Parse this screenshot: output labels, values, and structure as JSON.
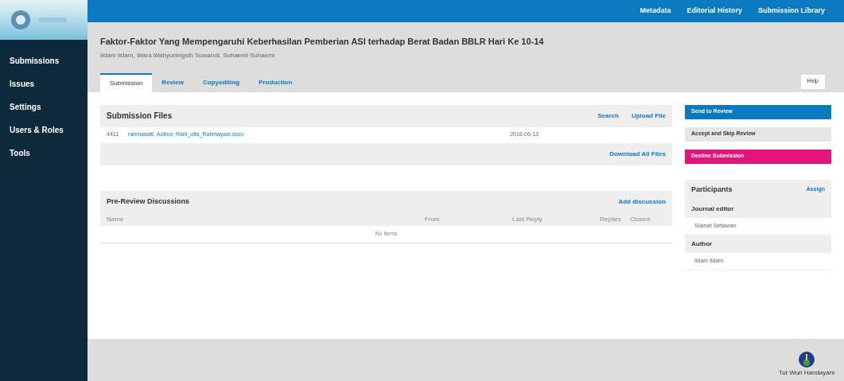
{
  "sidebar": {
    "items": [
      {
        "label": "Submissions",
        "selected": false
      },
      {
        "label": "Issues",
        "selected": false
      },
      {
        "label": "Settings",
        "selected": false
      },
      {
        "label": "Users & Roles",
        "selected": false
      },
      {
        "label": "Tools",
        "selected": false
      }
    ]
  },
  "top_links": [
    "Metadata",
    "Editorial History",
    "Submission Library"
  ],
  "submission": {
    "title": "Faktor-Faktor Yang Mempengaruhi Keberhasilan Pemberian ASI terhadap Berat Badan BBLR Hari Ke 10-14",
    "authors": "Ildam Ildam, Wara Wahyuningsih Suwandi, Suhaemi Suhaemi"
  },
  "tabs": [
    {
      "label": "Submission",
      "selected": true
    },
    {
      "label": "Review",
      "selected": false
    },
    {
      "label": "Copyediting",
      "selected": false
    },
    {
      "label": "Production",
      "selected": false
    }
  ],
  "help": "Help",
  "files": {
    "title": "Submission Files",
    "search": "Search",
    "upload": "Upload File",
    "rows": [
      {
        "id": "4411",
        "name": "rahmawati, Author, Rabi_ulfa_Rahmayani.docx",
        "date": "2016-06-13"
      }
    ],
    "download_all": "Download All Files"
  },
  "discussions": {
    "title": "Pre-Review Discussions",
    "add": "Add discussion",
    "columns": [
      "Name",
      "From",
      "Last Reply",
      "Replies",
      "Closed"
    ],
    "empty": "No Items"
  },
  "actions": [
    {
      "label": "Send to Review",
      "kind": "primary"
    },
    {
      "label": "Accept and Skip Review",
      "kind": "default"
    },
    {
      "label": "Decline Submission",
      "kind": "danger"
    }
  ],
  "participants": {
    "title": "Participants",
    "assign": "Assign",
    "groups": [
      {
        "role": "Journal editor",
        "people": [
          "Slamet Setiawan"
        ]
      },
      {
        "role": "Author",
        "people": [
          "Ildam Ildam"
        ]
      }
    ]
  },
  "footer": {
    "logo_caption": "Tut Wuri Handayani"
  }
}
